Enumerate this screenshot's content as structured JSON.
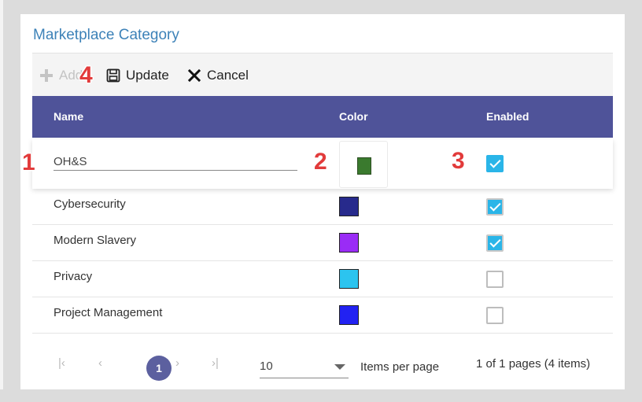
{
  "title": "Marketplace Category",
  "toolbar": {
    "add_label": "Add",
    "update_label": "Update",
    "cancel_label": "Cancel"
  },
  "columns": {
    "name": "Name",
    "color": "Color",
    "enabled": "Enabled"
  },
  "edit_row": {
    "name_value": "OH&S",
    "color": "#3a7a2e",
    "enabled": true
  },
  "rows": [
    {
      "name": "Cybersecurity",
      "color": "#272a8c",
      "enabled": true
    },
    {
      "name": "Modern Slavery",
      "color": "#9a2cf6",
      "enabled": true
    },
    {
      "name": "Privacy",
      "color": "#2cc4ef",
      "enabled": false
    },
    {
      "name": "Project Management",
      "color": "#2222f2",
      "enabled": false
    }
  ],
  "pager": {
    "current_page": "1",
    "page_size": "10",
    "items_per_page_label": "Items per page",
    "info": "1 of 1 pages (4 items)"
  },
  "annotations": [
    "1",
    "2",
    "3",
    "4"
  ],
  "colors": {
    "accent": "#3d82b8",
    "header_bg": "#4f5399",
    "checkbox_on": "#2ab5e8",
    "marker": "#e23b3b"
  }
}
